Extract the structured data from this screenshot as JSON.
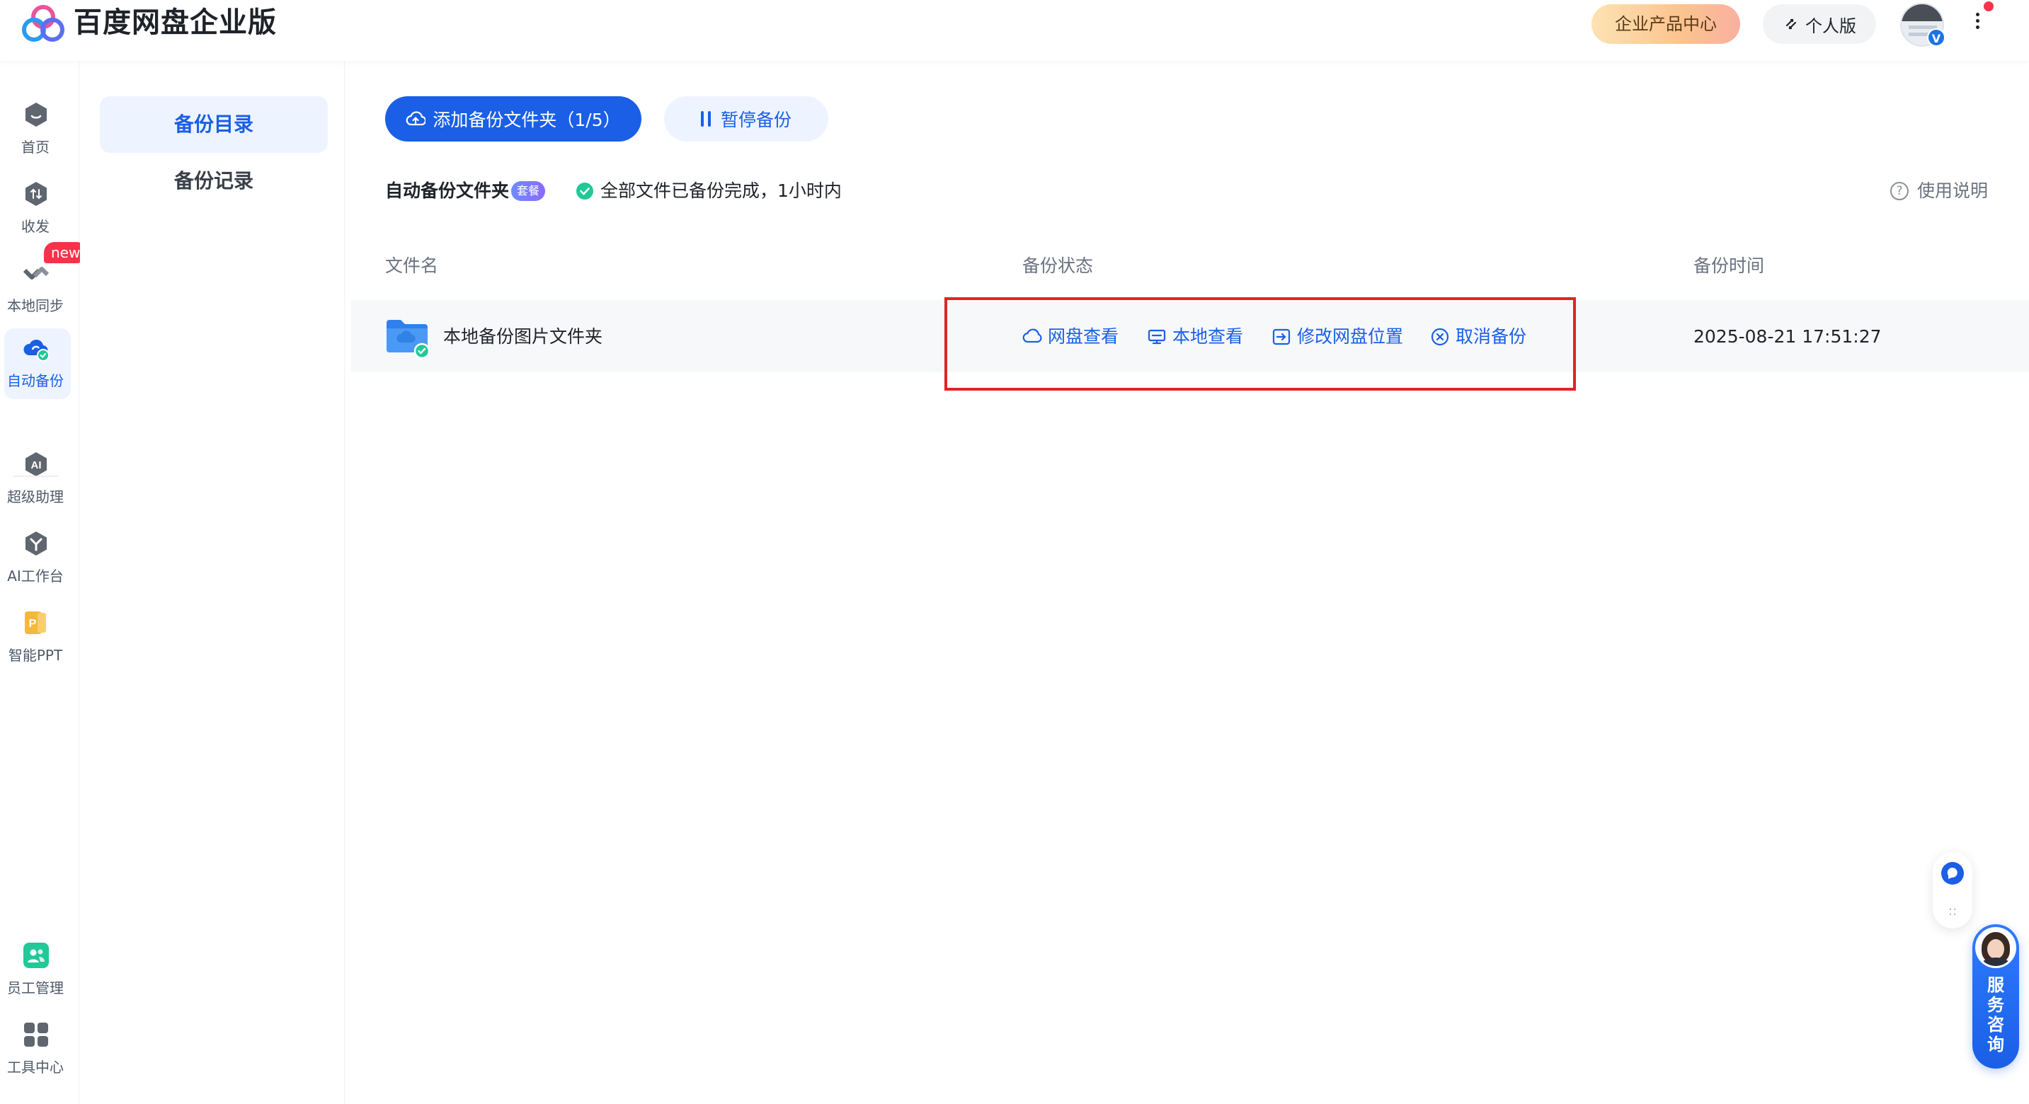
{
  "header": {
    "app_title": "百度网盘企业版",
    "enterprise_center": "企业产品中心",
    "personal_version": "个人版",
    "avatar_badge": "V"
  },
  "rail": {
    "items": [
      {
        "label": "首页",
        "icon": "home-icon"
      },
      {
        "label": "收发",
        "icon": "transfer-icon"
      },
      {
        "label": "本地同步",
        "icon": "sync-icon",
        "badge": "new"
      },
      {
        "label": "自动备份",
        "icon": "cloud-backup-icon",
        "active": true
      },
      {
        "label": "超级助理",
        "icon": "ai-icon"
      },
      {
        "label": "AI工作台",
        "icon": "ai-workbench-icon"
      },
      {
        "label": "智能PPT",
        "icon": "ppt-icon"
      },
      {
        "label": "员工管理",
        "icon": "staff-icon"
      },
      {
        "label": "工具中心",
        "icon": "tools-icon"
      }
    ]
  },
  "subnav": {
    "items": [
      {
        "label": "备份目录",
        "active": true
      },
      {
        "label": "备份记录"
      }
    ]
  },
  "toolbar": {
    "add_label": "添加备份文件夹（1/5）",
    "pause_label": "暂停备份"
  },
  "status": {
    "section_title": "自动备份文件夹",
    "tag": "套餐",
    "message": "全部文件已备份完成，1小时内",
    "help": "使用说明"
  },
  "table": {
    "columns": [
      "文件名",
      "备份状态",
      "备份时间"
    ],
    "rows": [
      {
        "name": "本地备份图片文件夹",
        "actions": [
          "网盘查看",
          "本地查看",
          "修改网盘位置",
          "取消备份"
        ],
        "time": "2025-08-21 17:51:27"
      }
    ]
  },
  "service": {
    "label": [
      "服",
      "务",
      "咨",
      "询"
    ]
  },
  "colors": {
    "primary": "#1a5fe6",
    "active_bg": "#eef4ff",
    "row_bg": "#f7f8fa",
    "highlight": "#e02424",
    "success": "#20c997"
  }
}
